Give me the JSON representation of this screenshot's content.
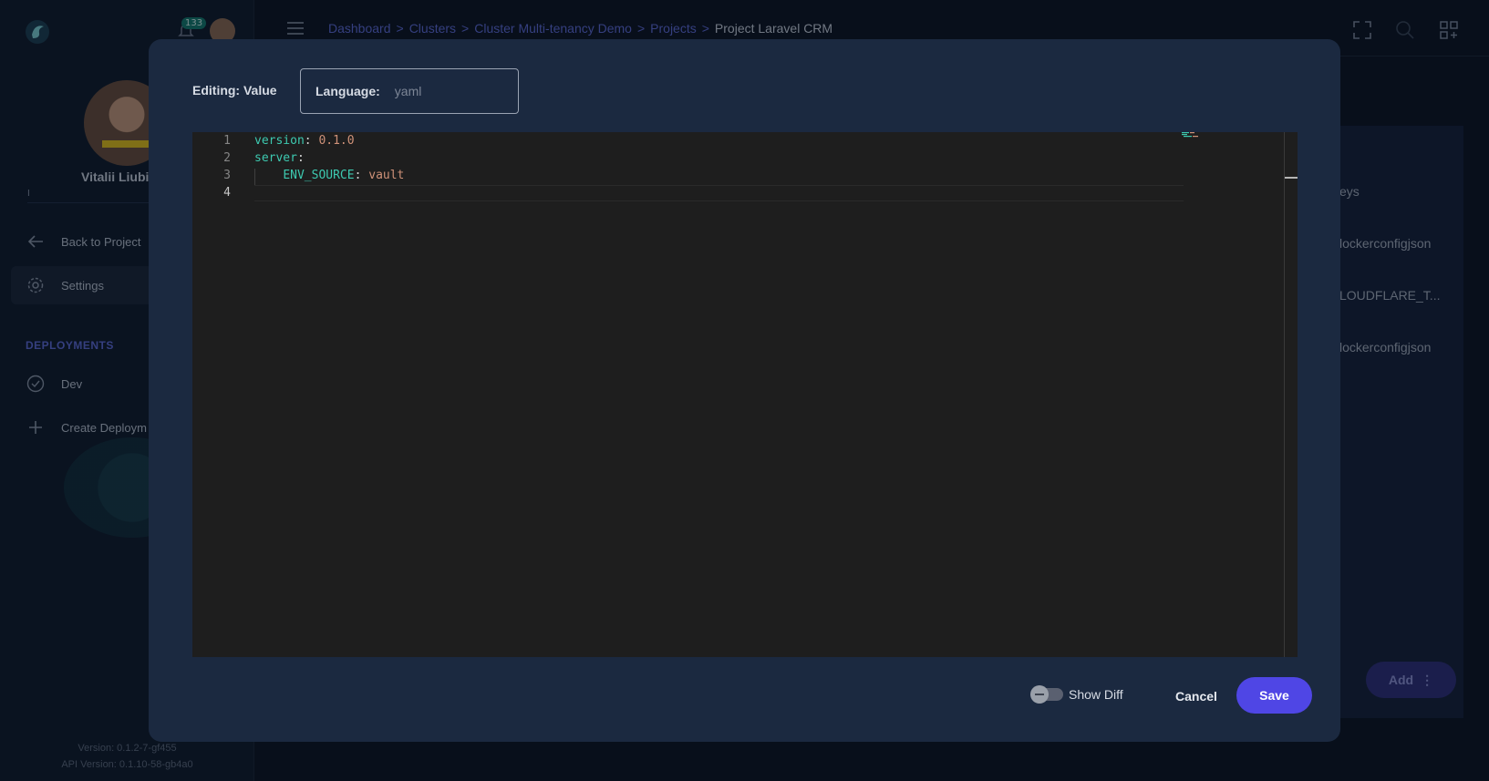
{
  "sidebar": {
    "notification_count": "133",
    "user_name": "Vitalii Liubi",
    "user_subline": "I",
    "nav": [
      {
        "label": "Back to Project",
        "icon": "arrow-left-icon"
      },
      {
        "label": "Settings",
        "icon": "gear-icon"
      }
    ],
    "section_title": "DEPLOYMENTS",
    "deployments": [
      {
        "label": "Dev",
        "icon": "check-circle-icon"
      },
      {
        "label": "Create Deploym",
        "icon": "plus-icon"
      }
    ],
    "version": "Version: 0.1.2-7-gf455",
    "api_version": "API Version: 0.1.10-58-gb4a0"
  },
  "topbar": {
    "breadcrumb": [
      {
        "label": "Dashboard"
      },
      {
        "label": "Clusters"
      },
      {
        "label": "Cluster Multi-tenancy Demo"
      },
      {
        "label": "Projects"
      },
      {
        "label": "Project Laravel CRM"
      }
    ],
    "separator": ">",
    "icons": [
      "fullscreen-icon",
      "search-icon",
      "apps-icon"
    ]
  },
  "right_panel": {
    "rows": [
      "eys",
      "lockerconfigjson",
      "LOUDFLARE_T...",
      "lockerconfigjson"
    ],
    "add_label": "Add"
  },
  "modal": {
    "editing_label": "Editing: Value",
    "language_label": "Language:",
    "language_value": "yaml",
    "editor": {
      "line_numbers": [
        "1",
        "2",
        "3",
        "4"
      ],
      "active_line": 4,
      "lines": [
        {
          "key": "version",
          "value": "0.1.0"
        },
        {
          "key": "server",
          "value": ""
        },
        {
          "key": "ENV_SOURCE",
          "value": "vault"
        }
      ]
    },
    "show_diff_label": "Show Diff",
    "cancel_label": "Cancel",
    "save_label": "Save",
    "colors": {
      "primary": "#4f46e5",
      "key": "#3dc9b0",
      "value": "#ce9178",
      "accent": "#5d6ad8"
    }
  }
}
